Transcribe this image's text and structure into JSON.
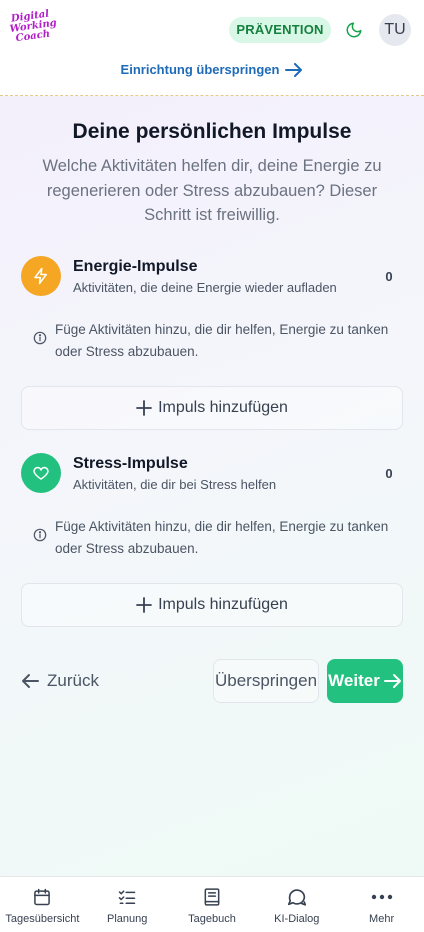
{
  "header": {
    "logo_lines": [
      "Digital",
      "Working",
      "Coach"
    ],
    "badge": "PRÄVENTION",
    "avatar_initials": "TU",
    "skip_setup": "Einrichtung überspringen"
  },
  "main": {
    "title": "Deine persönlichen Impulse",
    "subtitle": "Welche Aktivitäten helfen dir, deine Energie zu regenerieren oder Stress abzubauen? Dieser Schritt ist freiwillig."
  },
  "sections": [
    {
      "title": "Energie-Impulse",
      "description": "Aktivitäten, die deine Energie wieder aufladen",
      "count": "0",
      "hint": "Füge Aktivitäten hinzu, die dir helfen, Energie zu tanken oder Stress abzubauen.",
      "add_label": "Impuls hinzufügen",
      "icon": "lightning-icon",
      "color": "#f5a623"
    },
    {
      "title": "Stress-Impulse",
      "description": "Aktivitäten, die dir bei Stress helfen",
      "count": "0",
      "hint": "Füge Aktivitäten hinzu, die dir helfen, Energie zu tanken oder Stress abzubauen.",
      "add_label": "Impuls hinzufügen",
      "icon": "heart-icon",
      "color": "#22c17f"
    }
  ],
  "actions": {
    "back": "Zurück",
    "skip": "Überspringen",
    "next": "Weiter"
  },
  "bottom_nav": [
    {
      "label": "Tagesübersicht",
      "icon": "calendar-icon"
    },
    {
      "label": "Planung",
      "icon": "checklist-icon"
    },
    {
      "label": "Tagebuch",
      "icon": "book-icon"
    },
    {
      "label": "KI-Dialog",
      "icon": "chat-icon"
    },
    {
      "label": "Mehr",
      "icon": "more-icon"
    }
  ],
  "colors": {
    "accent_green": "#22c17f",
    "energy_orange": "#f5a623",
    "link_blue": "#1e6bb8"
  }
}
